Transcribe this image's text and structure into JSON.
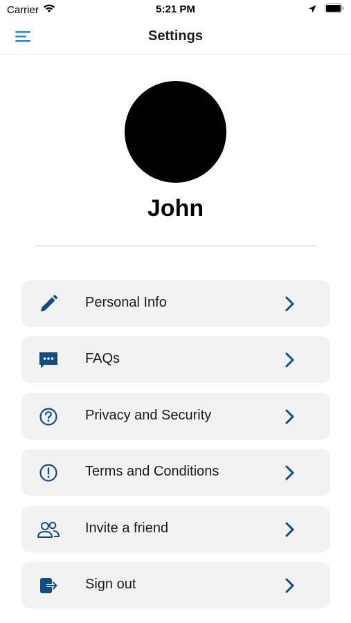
{
  "status_bar": {
    "carrier": "Carrier",
    "time": "5:21 PM"
  },
  "nav": {
    "title": "Settings",
    "menu_icon": "hamburger-menu-icon"
  },
  "profile": {
    "name": "John"
  },
  "menu": {
    "items": [
      {
        "label": "Personal Info",
        "icon": "pencil-icon"
      },
      {
        "label": "FAQs",
        "icon": "chat-bubble-icon"
      },
      {
        "label": "Privacy and Security",
        "icon": "question-circle-icon"
      },
      {
        "label": "Terms and Conditions",
        "icon": "exclamation-circle-icon"
      },
      {
        "label": "Invite a friend",
        "icon": "people-icon"
      },
      {
        "label": "Sign out",
        "icon": "sign-out-icon"
      }
    ]
  },
  "colors": {
    "accent": "#1f8fe0",
    "icon": "#0f4c8a",
    "card_bg": "#f2f2f2"
  }
}
